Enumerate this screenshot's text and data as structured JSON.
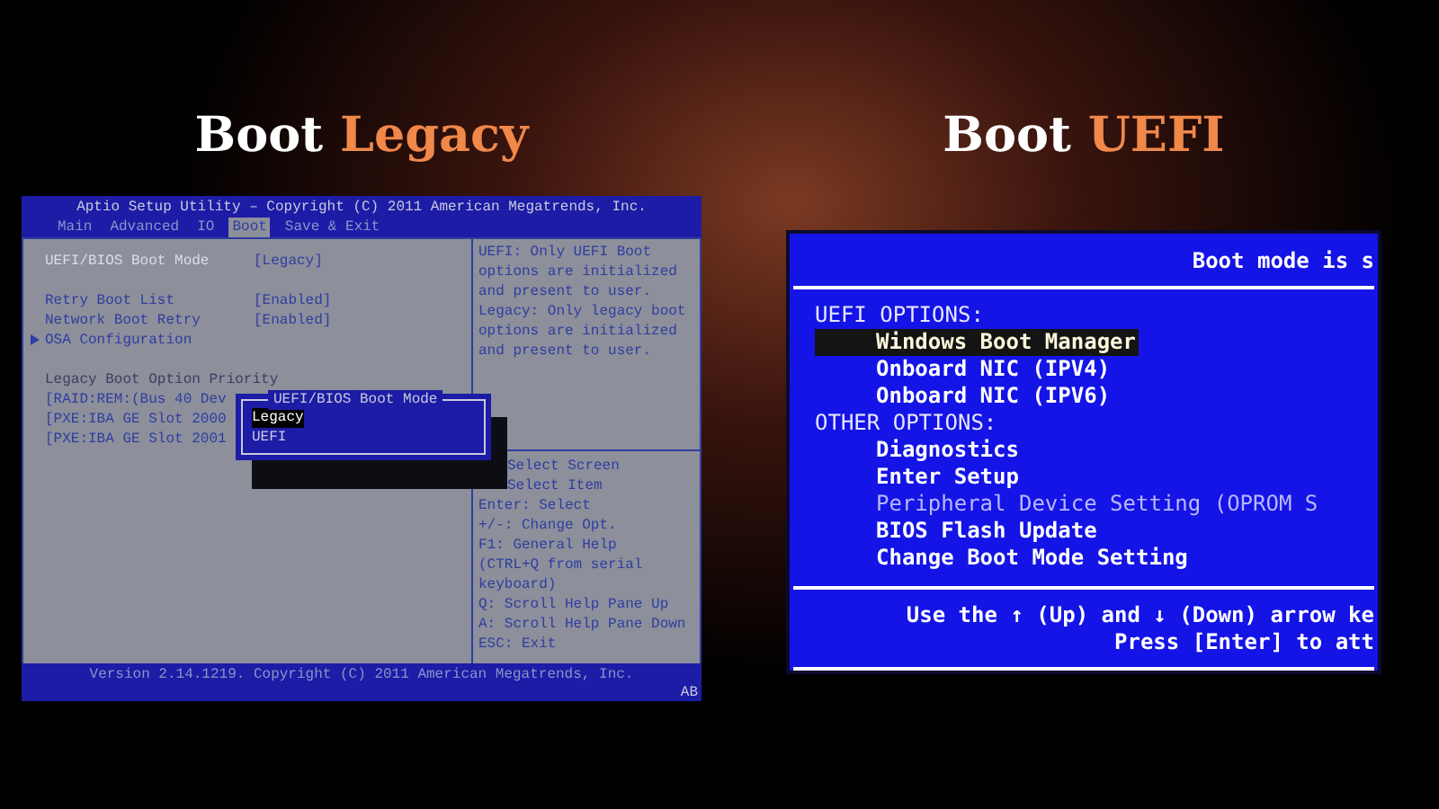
{
  "headings": [
    {
      "text": "Boot",
      "accent": "Legacy"
    },
    {
      "text": "Boot",
      "accent": "UEFI"
    }
  ],
  "legacy_screen": {
    "title": "Aptio Setup Utility – Copyright (C) 2011 American Megatrends, Inc.",
    "tabs": [
      {
        "label": "Main",
        "selected": false
      },
      {
        "label": "Advanced",
        "selected": false
      },
      {
        "label": "IO",
        "selected": false
      },
      {
        "label": "Boot",
        "selected": true
      },
      {
        "label": "Save & Exit",
        "selected": false
      }
    ],
    "groups": [
      [
        {
          "kind": "setting",
          "label": "UEFI/BIOS Boot Mode",
          "value": "[Legacy]",
          "highlighted": true
        }
      ],
      [
        {
          "kind": "setting",
          "label": "Retry Boot List",
          "value": "[Enabled]",
          "highlighted": false
        },
        {
          "kind": "setting",
          "label": "Network Boot Retry",
          "value": "[Enabled]",
          "highlighted": false
        },
        {
          "kind": "submenu",
          "label": "OSA Configuration",
          "highlighted": false
        }
      ],
      [
        {
          "kind": "heading",
          "label": "Legacy Boot Option Priority",
          "highlighted": false
        },
        {
          "kind": "option",
          "label": "[RAID:REM:(Bus 40 Dev",
          "highlighted": false
        },
        {
          "kind": "option",
          "label": "[PXE:IBA GE Slot 2000",
          "highlighted": false
        },
        {
          "kind": "option",
          "label": "[PXE:IBA GE Slot 2001",
          "highlighted": false
        }
      ]
    ],
    "help": "UEFI: Only UEFI Boot options are initialized and present to user. Legacy: Only legacy boot options are initialized and present to user.",
    "keys": [
      "Select Screen",
      "Select Item",
      "Enter: Select",
      "+/-: Change Opt.",
      "F1: General Help",
      "(CTRL+Q from serial keyboard)",
      "Q: Scroll Help Pane Up",
      "A: Scroll Help Pane Down",
      "ESC: Exit"
    ],
    "popup": {
      "title": "UEFI/BIOS Boot Mode",
      "options": [
        {
          "label": "Legacy",
          "selected": true
        },
        {
          "label": "UEFI",
          "selected": false
        }
      ]
    },
    "footer": "Version 2.14.1219. Copyright (C) 2011 American Megatrends, Inc.",
    "corner": "AB"
  },
  "uefi_screen": {
    "header": "Boot mode is s",
    "sections": [
      {
        "label": "UEFI OPTIONS:",
        "items": [
          {
            "label": "Windows Boot Manager",
            "selected": true,
            "disabled": false
          },
          {
            "label": "Onboard NIC (IPV4)",
            "selected": false,
            "disabled": false
          },
          {
            "label": "Onboard NIC (IPV6)",
            "selected": false,
            "disabled": false
          }
        ]
      },
      {
        "label": "OTHER OPTIONS:",
        "items": [
          {
            "label": "Diagnostics",
            "selected": false,
            "disabled": false
          },
          {
            "label": "Enter Setup",
            "selected": false,
            "disabled": false
          },
          {
            "label": "Peripheral Device Setting (OPROM S",
            "selected": false,
            "disabled": true
          },
          {
            "label": "BIOS Flash Update",
            "selected": false,
            "disabled": false
          },
          {
            "label": "Change Boot Mode Setting",
            "selected": false,
            "disabled": false
          }
        ]
      }
    ],
    "footer": [
      "Use the ↑ (Up) and ↓ (Down) arrow ke",
      "Press [Enter] to att"
    ]
  }
}
